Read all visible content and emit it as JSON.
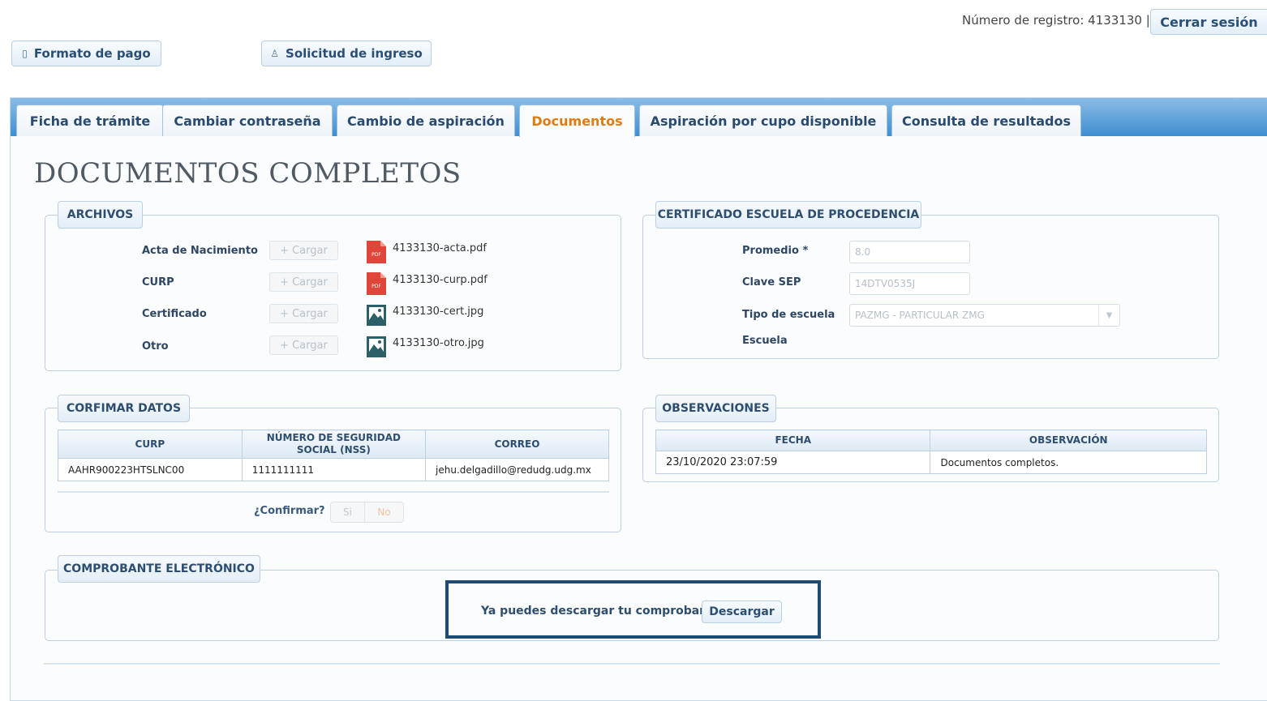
{
  "header": {
    "registro_text": "Número de registro: 4133130 |",
    "logout_label": "Cerrar sesión",
    "formato_label": "Formato de pago",
    "solicitud_label": "Solicitud de ingreso"
  },
  "tabs": [
    {
      "label": "Ficha de trámite"
    },
    {
      "label": "Cambiar contraseña"
    },
    {
      "label": "Cambio de aspiración"
    },
    {
      "label": "Documentos",
      "active": true
    },
    {
      "label": "Aspiración por cupo disponible"
    },
    {
      "label": "Consulta de resultados"
    }
  ],
  "page_title": "DOCUMENTOS COMPLETOS",
  "archivos": {
    "legend": "ARCHIVOS",
    "upload_label": "Cargar",
    "rows": [
      {
        "label": "Acta de Nacimiento",
        "file": "4133130-acta.pdf",
        "icon": "pdf-icon"
      },
      {
        "label": "CURP",
        "file": "4133130-curp.pdf",
        "icon": "pdf-icon"
      },
      {
        "label": "Certificado",
        "file": "4133130-cert.jpg",
        "icon": "image-icon"
      },
      {
        "label": "Otro",
        "file": "4133130-otro.jpg",
        "icon": "image-icon"
      }
    ]
  },
  "certificado": {
    "legend": "CERTIFICADO ESCUELA DE PROCEDENCIA",
    "promedio_label": "Promedio *",
    "promedio_value": "8.0",
    "clave_label": "Clave SEP",
    "clave_value": "14DTV0535J",
    "tipo_label": "Tipo de escuela",
    "tipo_value": "PAZMG - PARTICULAR ZMG",
    "escuela_label": "Escuela"
  },
  "confirmar_datos": {
    "legend": "CORFIMAR DATOS",
    "headers": [
      "CURP",
      "NÚMERO DE SEGURIDAD SOCIAL (NSS)",
      "CORREO"
    ],
    "row": [
      "AAHR900223HTSLNC00",
      "1111111111",
      "jehu.delgadillo@redudg.udg.mx"
    ],
    "confirm_label": "¿Confirmar?",
    "yes_label": "Si",
    "no_label": "No"
  },
  "observaciones": {
    "legend": "OBSERVACIONES",
    "headers": [
      "FECHA",
      "OBSERVACIÓN"
    ],
    "row": [
      "23/10/2020 23:07:59",
      "Documentos completos."
    ]
  },
  "comprobante": {
    "legend": "COMPROBANTE ELECTRÓNICO",
    "message": "Ya puedes descargar tu comprobante.",
    "download_label": "Descargar"
  },
  "colors": {
    "tab_bar": "#3f8fd1",
    "active_tab_text": "#e07b12",
    "highlight_border": "#1e4a74",
    "pdf_icon": "#e0453a",
    "image_icon": "#2c5f68"
  }
}
